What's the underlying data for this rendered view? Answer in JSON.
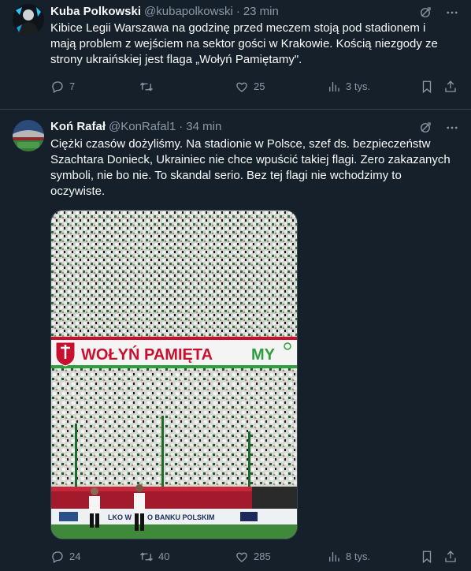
{
  "tweets": [
    {
      "name": "Kuba Polkowski",
      "handle": "@kubapolkowski",
      "separator": "·",
      "time": "23 min",
      "text": "Kibice Legii Warszawa na godzinę przed meczem stoją pod stadionem i mają problem z wejściem na sektor gości w Krakowie. Kością niezgody ze strony ukraińskiej jest flaga „Wołyń Pamiętamy\".",
      "replies": "7",
      "retweets": "",
      "likes": "25",
      "views": "3 tys."
    },
    {
      "name": "Koń Rafał",
      "handle": "@KonRafal1",
      "separator": "·",
      "time": "34 min",
      "text": "Ciężki czasów dożyliśmy. Na stadionie w Polsce, szef ds. bezpieczeństw Szachtara  Donieck, Ukrainiec nie chce wpuścić takiej flagi. Zero zakazanych symboli, nie bo nie. To skandal serio. Bez tej flagi nie wchodzimy to oczywiste.",
      "replies": "24",
      "retweets": "40",
      "likes": "285",
      "views": "8 tys.",
      "media": {
        "banner_text_1": "WOŁYŃ PAMIĘTA",
        "banner_text_2": "MY",
        "ad_text": "LKO W",
        "ad_text_2": "O BANKU POLSKIM"
      }
    }
  ],
  "colors": {
    "background": "#15202b",
    "text": "#f7f9f9",
    "muted": "#8b98a5",
    "border": "#38444d",
    "banner_green": "#2e9e3e",
    "banner_red": "#c8102e"
  },
  "icons": [
    "grok-icon",
    "more-icon",
    "reply-icon",
    "retweet-icon",
    "like-icon",
    "views-icon",
    "bookmark-icon",
    "share-icon"
  ]
}
